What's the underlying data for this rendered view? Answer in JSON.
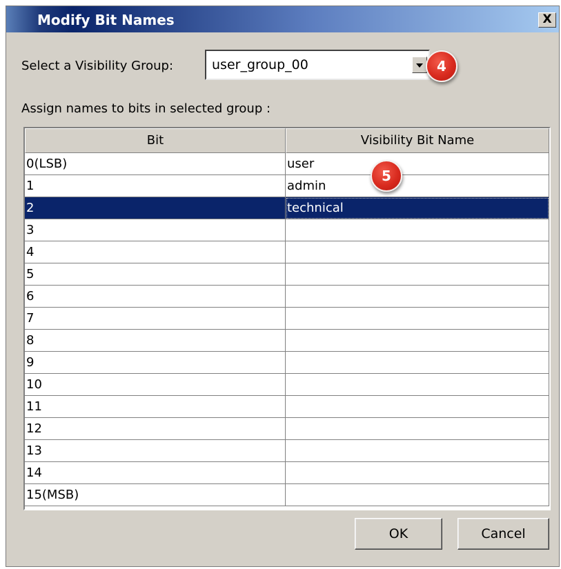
{
  "window": {
    "title": "Modify Bit Names",
    "close_glyph": "X"
  },
  "group_select": {
    "label": "Select a Visibility Group:",
    "value": "user_group_00"
  },
  "assign_label": "Assign names to bits in selected group :",
  "table": {
    "columns": [
      "Bit",
      "Visibility Bit Name"
    ],
    "rows": [
      {
        "bit": "0(LSB)",
        "name": "user"
      },
      {
        "bit": "1",
        "name": "admin"
      },
      {
        "bit": "2",
        "name": "technical"
      },
      {
        "bit": "3",
        "name": ""
      },
      {
        "bit": "4",
        "name": ""
      },
      {
        "bit": "5",
        "name": ""
      },
      {
        "bit": "6",
        "name": ""
      },
      {
        "bit": "7",
        "name": ""
      },
      {
        "bit": "8",
        "name": ""
      },
      {
        "bit": "9",
        "name": ""
      },
      {
        "bit": "10",
        "name": ""
      },
      {
        "bit": "11",
        "name": ""
      },
      {
        "bit": "12",
        "name": ""
      },
      {
        "bit": "13",
        "name": ""
      },
      {
        "bit": "14",
        "name": ""
      },
      {
        "bit": "15(MSB)",
        "name": ""
      }
    ],
    "selected_row": "2"
  },
  "callouts": [
    "4",
    "5"
  ],
  "buttons": {
    "ok": "OK",
    "cancel": "Cancel"
  },
  "colors": {
    "selection": "#0a246a",
    "callout": "#d92b1f",
    "dialog_bg": "#d4d0c8"
  }
}
